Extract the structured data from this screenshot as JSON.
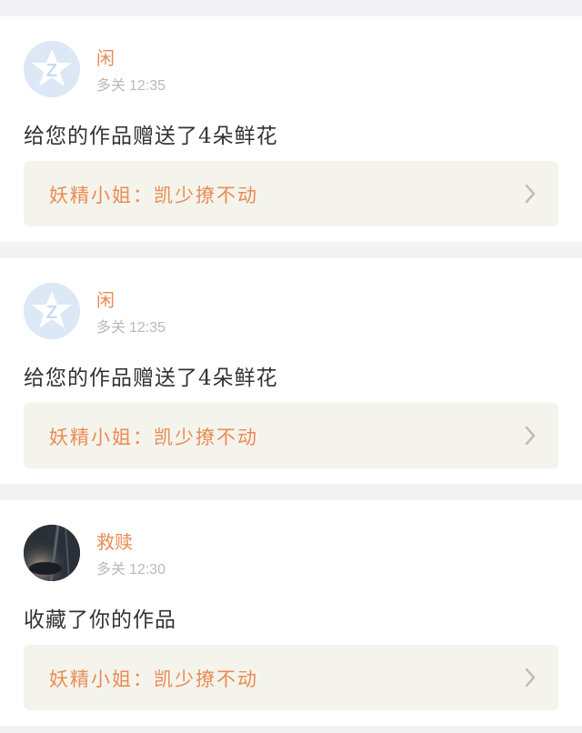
{
  "notifications": [
    {
      "user_name": "闲",
      "user_tag": "多关",
      "time": "12:35",
      "message": "给您的作品赠送了4朵鲜花",
      "quoted_text": "妖精小姐：凯少撩不动",
      "avatar": "default-qq-avatar-icon"
    },
    {
      "user_name": "闲",
      "user_tag": "多关",
      "time": "12:35",
      "message": "给您的作品赠送了4朵鲜花",
      "quoted_text": "妖精小姐：凯少撩不动",
      "avatar": "default-qq-avatar-icon"
    },
    {
      "user_name": "救赎",
      "user_tag": "多关",
      "time": "12:30",
      "message": "收藏了你的作品",
      "quoted_text": "妖精小姐：凯少撩不动",
      "avatar": "photo-avatar"
    }
  ],
  "colors": {
    "accent": "#e88a52",
    "card_bg": "#ffffff",
    "page_bg": "#f3f2f4",
    "quote_bg": "#f4f4ec",
    "muted": "#b9b9b9"
  },
  "icons": {
    "default_avatar": "qq-z-star-icon",
    "chevron": "chevron-right-icon"
  }
}
